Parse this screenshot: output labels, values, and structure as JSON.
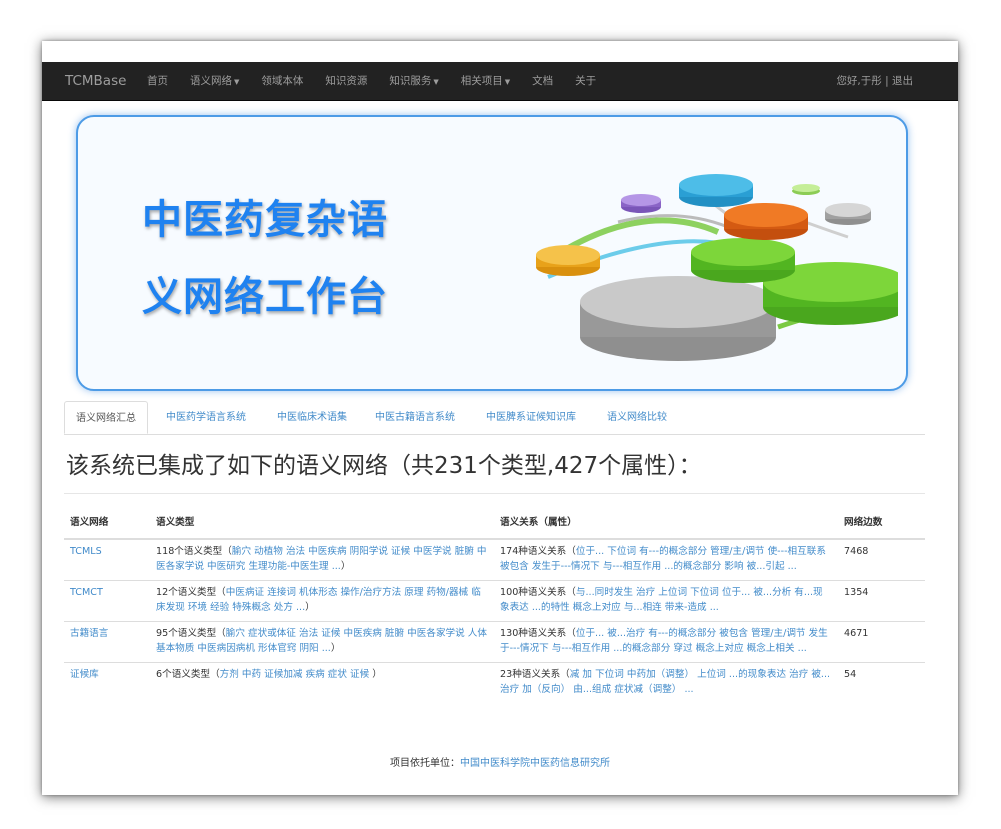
{
  "navbar": {
    "brand": "TCMBase",
    "items": [
      {
        "label": "首页",
        "caret": false
      },
      {
        "label": "语义网络",
        "caret": true
      },
      {
        "label": "领域本体",
        "caret": false
      },
      {
        "label": "知识资源",
        "caret": false
      },
      {
        "label": "知识服务",
        "caret": true
      },
      {
        "label": "相关项目",
        "caret": true
      },
      {
        "label": "文档",
        "caret": false
      },
      {
        "label": "关于",
        "caret": false
      }
    ],
    "greeting": "您好,于彤",
    "separator": " | ",
    "logout": "退出"
  },
  "banner": {
    "line1": "中医药复杂语",
    "line2": "义网络工作台"
  },
  "tabs": [
    "语义网络汇总",
    "中医药学语言系统",
    "中医临床术语集",
    "中医古籍语言系统",
    "中医脾系证候知识库",
    "语义网络比较"
  ],
  "heading": "该系统已集成了如下的语义网络（共231个类型,427个属性）：",
  "table": {
    "headers": [
      "语义网络",
      "语义类型",
      "语义关系（属性）",
      "网络边数"
    ],
    "rows": [
      {
        "network": "TCMLS",
        "types_prefix": "118个语义类型（",
        "types_links": "腧穴 动植物 治法 中医疾病 阴阳学说 证候 中医学说 脏腑 中医各家学说 中医研究 生理功能-中医生理 ...",
        "types_suffix": "）",
        "relations_prefix": "174种语义关系（",
        "relations_links": "位于... 下位词 有---的概念部分 管理/主/调节 使---相互联系 被包含 发生于---情况下 与---相互作用 ...的概念部分 影响 被...引起 ...",
        "relations_suffix": "",
        "edges": "7468"
      },
      {
        "network": "TCMCT",
        "types_prefix": "12个语义类型（",
        "types_links": "中医病证 连接词 机体形态 操作/治疗方法 原理 药物/器械 临床发现 环境 经验 特殊概念 处方 ...",
        "types_suffix": "）",
        "relations_prefix": "100种语义关系（",
        "relations_links": "与...同时发生 治疗 上位词 下位词 位于... 被...分析 有...现象表达 ...的特性 概念上对应 与...相连 带来-造成 ...",
        "relations_suffix": "",
        "edges": "1354"
      },
      {
        "network": "古籍语言",
        "types_prefix": "95个语义类型（",
        "types_links": "腧穴 症状或体征 治法 证候 中医疾病 脏腑 中医各家学说 人体基本物质 中医病因病机 形体官窍 阴阳 ...",
        "types_suffix": "）",
        "relations_prefix": "130种语义关系（",
        "relations_links": "位于... 被...治疗 有---的概念部分 被包含 管理/主/调节 发生于---情况下 与---相互作用 ...的概念部分 穿过 概念上对应 概念上相关 ...",
        "relations_suffix": "",
        "edges": "4671"
      },
      {
        "network": "证候库",
        "types_prefix": "6个语义类型（",
        "types_links": "方剂 中药 证候加减 疾病 症状 证候 ",
        "types_suffix": "）",
        "relations_prefix": "23种语义关系（",
        "relations_links": "减 加 下位词 中药加（调整） 上位词 ...的现象表达 治疗 被...治疗 加（反向） 由...组成 症状减（调整） ...",
        "relations_suffix": "",
        "edges": "54"
      }
    ]
  },
  "footer": {
    "prefix": "项目依托单位：",
    "link": "中国中医科学院中医药信息研究所"
  }
}
